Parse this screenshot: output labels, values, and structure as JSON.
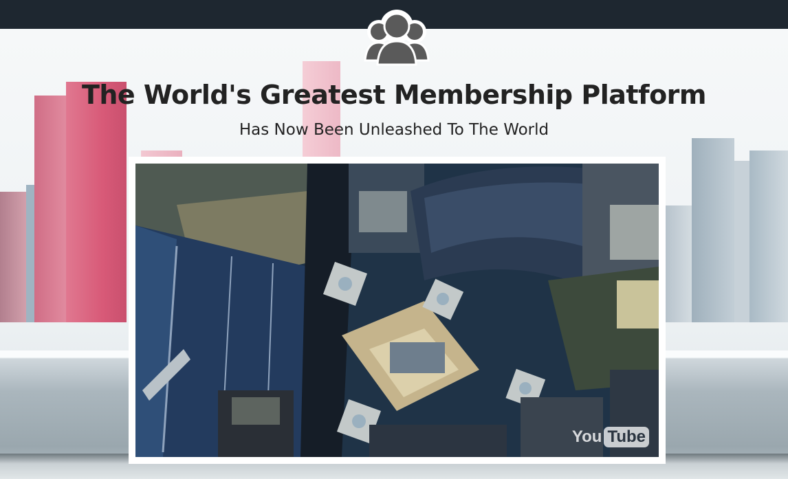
{
  "hero": {
    "headline": "The World's Greatest Membership Platform",
    "subheadline": "Has Now Been Unleashed To The World",
    "icon": "members-group-icon"
  },
  "video": {
    "provider_logo_left": "You",
    "provider_logo_right": "Tube",
    "thumbnail": "aerial-city-rooftops"
  },
  "colors": {
    "topbar": "#1e2730",
    "icon": "#5a5a5a",
    "headline": "#222222",
    "frame": "#ffffff"
  }
}
